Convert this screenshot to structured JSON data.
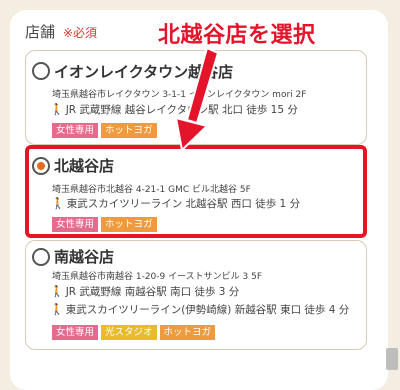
{
  "section": {
    "label": "店舗",
    "required": "※必須"
  },
  "annotation": "北越谷店を選択",
  "stores": [
    {
      "name": "イオンレイクタウン越谷店",
      "address": "埼玉県越谷市レイクタウン 3-1-1 イオンレイクタウン mori 2F",
      "access": [
        "JR 武蔵野線 越谷レイクタウン駅 北口 徒歩 15 分"
      ],
      "tags": [
        {
          "label": "女性専用",
          "color": "#e46b8c"
        },
        {
          "label": "ホットヨガ",
          "color": "#f09a3e"
        }
      ],
      "selected": false
    },
    {
      "name": "北越谷店",
      "address": "埼玉県越谷市北越谷 4-21-1 GMC ビル北越谷 5F",
      "access": [
        "東武スカイツリーライン 北越谷駅 西口 徒歩 1 分"
      ],
      "tags": [
        {
          "label": "女性専用",
          "color": "#e46b8c"
        },
        {
          "label": "ホットヨガ",
          "color": "#f09a3e"
        }
      ],
      "selected": true
    },
    {
      "name": "南越谷店",
      "address": "埼玉県越谷市南越谷 1-20-9 イーストサンビル 3 5F",
      "access": [
        "JR 武蔵野線 南越谷駅 南口 徒歩 3 分",
        "東武スカイツリーライン(伊勢崎線) 新越谷駅 東口 徒歩 4 分"
      ],
      "tags": [
        {
          "label": "女性専用",
          "color": "#e46b8c"
        },
        {
          "label": "光スタジオ",
          "color": "#e8bb2c"
        },
        {
          "label": "ホットヨガ",
          "color": "#f09a3e"
        }
      ],
      "selected": false
    }
  ],
  "colors": {
    "highlight": "#e51524",
    "radio_selected": "#e46a1e",
    "walk_icon": "#f09a1a"
  },
  "icons": {
    "access": "walking-person-icon",
    "annotation_arrow": "red-arrow-icon"
  }
}
